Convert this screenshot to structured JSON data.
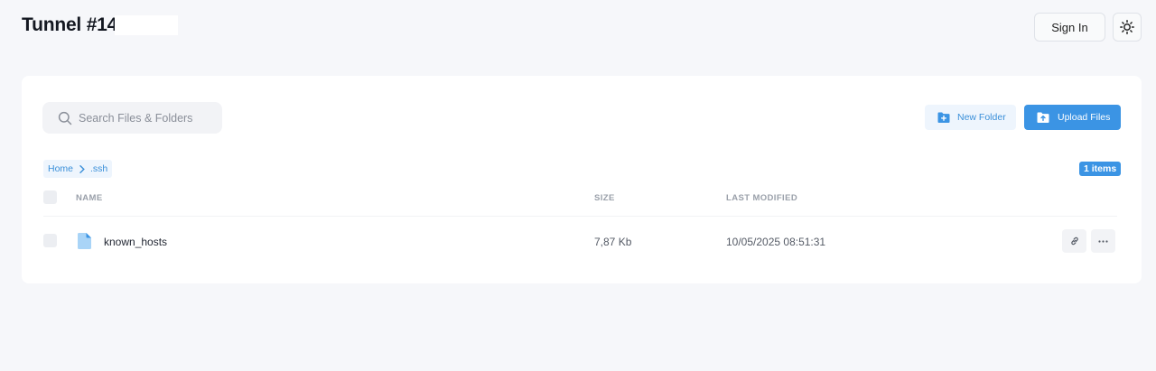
{
  "header": {
    "title": "Tunnel #14",
    "sign_in_label": "Sign In",
    "theme_toggle_icon": "sun-icon"
  },
  "toolbar": {
    "search_placeholder": "Search Files & Folders",
    "search_value": "",
    "new_folder_label": "New Folder",
    "upload_label": "Upload Files"
  },
  "breadcrumb": {
    "items": [
      "Home",
      ".ssh"
    ]
  },
  "item_count": "1 items",
  "table": {
    "columns": [
      "NAME",
      "SIZE",
      "LAST MODIFIED"
    ],
    "rows": [
      {
        "name": "known_hosts",
        "size": "7,87 Kb",
        "modified": "10/05/2025 08:51:31",
        "icon": "file-icon"
      }
    ]
  },
  "colors": {
    "accent": "#3b94e4",
    "accent_light": "#eef5fd",
    "background": "#f6f7fa"
  }
}
